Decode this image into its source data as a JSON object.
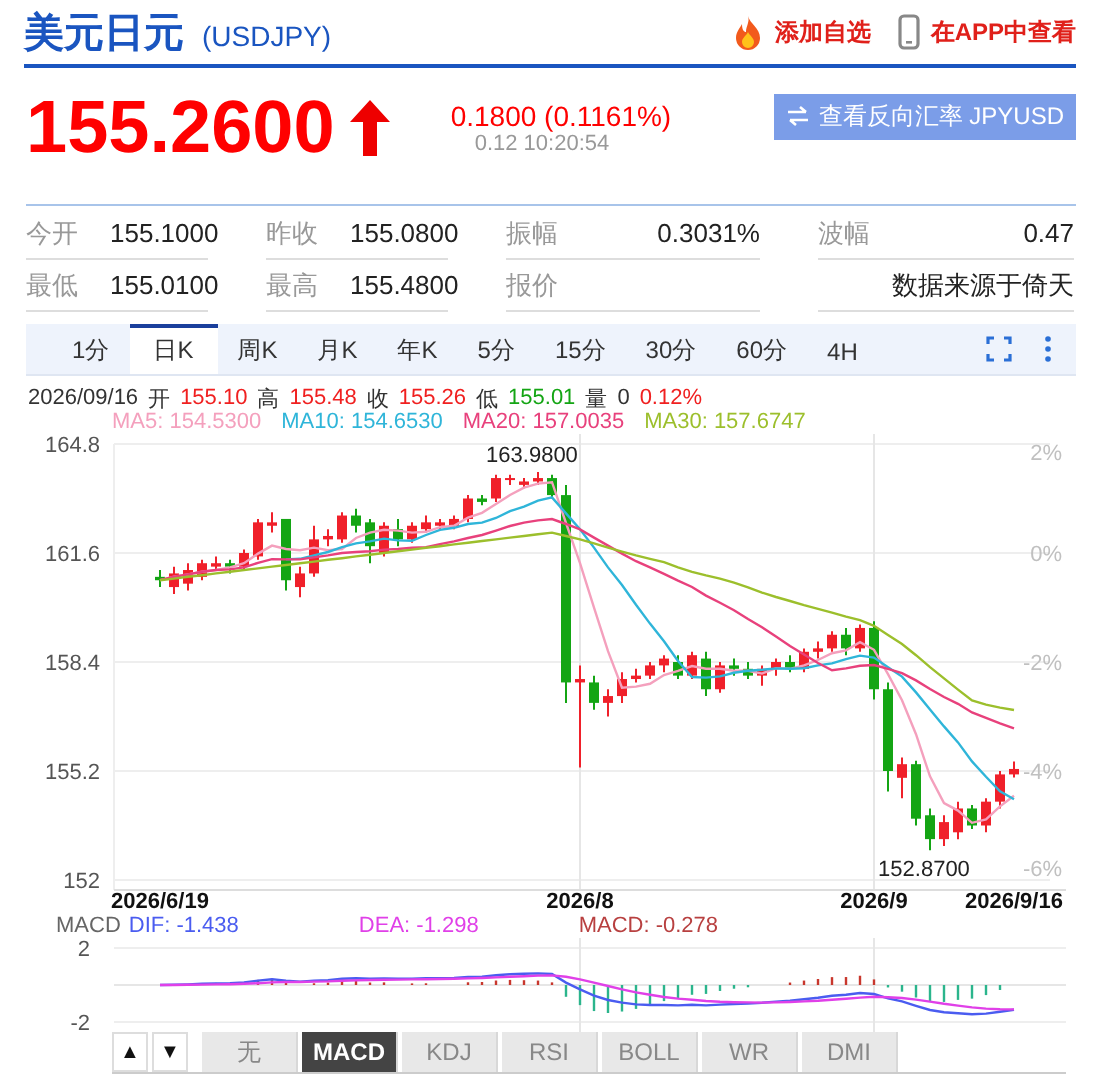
{
  "header": {
    "title": "美元日元",
    "code": "(USDJPY)",
    "actions": [
      {
        "kind": "fire",
        "label": "添加自选"
      },
      {
        "kind": "phone",
        "label": "在APP中查看"
      }
    ]
  },
  "quote": {
    "price": "155.2600",
    "change": "0.1800 (0.1161%)",
    "time": "0.12 10:20:54",
    "reverse_button": "查看反向汇率 JPYUSD"
  },
  "stats": [
    {
      "label": "今开",
      "value": "155.1000"
    },
    {
      "label": "昨收",
      "value": "155.0800"
    },
    {
      "label": "振幅",
      "value": "0.3031%"
    },
    {
      "label": "波幅",
      "value": "0.47"
    },
    {
      "label": "最低",
      "value": "155.0100"
    },
    {
      "label": "最高",
      "value": "155.4800"
    },
    {
      "label": "报价"
    },
    {
      "value": "数据来源于倚天"
    }
  ],
  "period_tabs": [
    {
      "label": "1分",
      "selected": false
    },
    {
      "label": "日K",
      "selected": true
    },
    {
      "label": "周K",
      "selected": false
    },
    {
      "label": "月K",
      "selected": false
    },
    {
      "label": "年K",
      "selected": false
    },
    {
      "label": "5分",
      "selected": false
    },
    {
      "label": "15分",
      "selected": false
    },
    {
      "label": "30分",
      "selected": false
    },
    {
      "label": "60分",
      "selected": false
    },
    {
      "label": "4H",
      "selected": false
    }
  ],
  "kline": {
    "date": "2026/09/16",
    "info": [
      {
        "label": "开",
        "value": "155.10",
        "color": "#f02020"
      },
      {
        "label": "高",
        "value": "155.48",
        "color": "#f02020"
      },
      {
        "label": "收",
        "value": "155.26",
        "color": "#f02020"
      },
      {
        "label": "低",
        "value": "155.01",
        "color": "#14a514"
      },
      {
        "label": "量",
        "value": "0",
        "color": "#333333"
      },
      {
        "value": "0.12%",
        "color": "#f02020"
      }
    ],
    "percent_labels": [
      "2%",
      "0%",
      "-2%",
      "-4%",
      "-6%"
    ],
    "chart_data": {
      "type": "candlestick",
      "grid": true,
      "ohlc": [
        [
          160.9,
          161.1,
          160.6,
          160.8
        ],
        [
          160.6,
          161.2,
          160.4,
          161.0
        ],
        [
          160.7,
          161.3,
          160.5,
          161.1
        ],
        [
          160.9,
          161.4,
          160.8,
          161.3
        ],
        [
          161.2,
          161.5,
          161.1,
          161.3
        ],
        [
          161.3,
          161.4,
          161.0,
          161.2
        ],
        [
          161.2,
          161.7,
          161.1,
          161.6
        ],
        [
          161.5,
          162.6,
          161.4,
          162.5
        ],
        [
          162.4,
          162.8,
          162.2,
          162.5
        ],
        [
          162.6,
          162.6,
          160.5,
          160.8
        ],
        [
          160.6,
          161.2,
          160.3,
          161.0
        ],
        [
          161.0,
          162.4,
          160.9,
          162.0
        ],
        [
          162.0,
          162.3,
          161.8,
          162.1
        ],
        [
          162.0,
          162.8,
          161.9,
          162.7
        ],
        [
          162.7,
          162.9,
          162.2,
          162.4
        ],
        [
          162.5,
          162.6,
          161.3,
          161.8
        ],
        [
          161.6,
          162.5,
          161.5,
          162.4
        ],
        [
          162.3,
          162.6,
          161.8,
          162.0
        ],
        [
          162.0,
          162.5,
          161.9,
          162.4
        ],
        [
          162.3,
          162.7,
          162.2,
          162.5
        ],
        [
          162.4,
          162.6,
          162.3,
          162.5
        ],
        [
          162.4,
          162.7,
          162.3,
          162.6
        ],
        [
          162.6,
          163.3,
          162.5,
          163.2
        ],
        [
          163.2,
          163.3,
          163.0,
          163.1
        ],
        [
          163.2,
          163.9,
          163.1,
          163.8
        ],
        [
          163.8,
          163.9,
          163.6,
          163.8
        ],
        [
          163.6,
          163.8,
          163.5,
          163.7
        ],
        [
          163.7,
          163.98,
          163.6,
          163.8
        ],
        [
          163.8,
          163.9,
          163.2,
          163.3
        ],
        [
          163.3,
          163.6,
          157.2,
          157.8
        ],
        [
          157.8,
          158.3,
          155.3,
          157.9
        ],
        [
          157.8,
          158.0,
          157.0,
          157.2
        ],
        [
          157.2,
          157.6,
          156.8,
          157.4
        ],
        [
          157.4,
          158.1,
          157.2,
          157.9
        ],
        [
          157.9,
          158.2,
          157.8,
          158.0
        ],
        [
          158.0,
          158.4,
          157.9,
          158.3
        ],
        [
          158.3,
          158.6,
          158.1,
          158.5
        ],
        [
          158.4,
          158.6,
          157.9,
          158.0
        ],
        [
          158.0,
          158.7,
          157.9,
          158.6
        ],
        [
          158.5,
          158.7,
          157.4,
          157.6
        ],
        [
          157.6,
          158.4,
          157.5,
          158.3
        ],
        [
          158.3,
          158.5,
          158.0,
          158.2
        ],
        [
          158.2,
          158.4,
          157.9,
          158.0
        ],
        [
          158.0,
          158.3,
          157.7,
          158.2
        ],
        [
          158.2,
          158.5,
          158.0,
          158.4
        ],
        [
          158.4,
          158.6,
          158.1,
          158.2
        ],
        [
          158.2,
          158.8,
          158.1,
          158.7
        ],
        [
          158.7,
          159.0,
          158.5,
          158.8
        ],
        [
          158.8,
          159.3,
          158.7,
          159.2
        ],
        [
          159.2,
          159.4,
          158.6,
          158.8
        ],
        [
          158.8,
          159.5,
          158.7,
          159.4
        ],
        [
          159.4,
          159.6,
          157.3,
          157.6
        ],
        [
          157.6,
          157.8,
          154.6,
          155.2
        ],
        [
          155.0,
          155.6,
          154.4,
          155.4
        ],
        [
          155.4,
          155.5,
          153.6,
          153.8
        ],
        [
          153.9,
          154.1,
          152.87,
          153.2
        ],
        [
          153.2,
          153.9,
          153.0,
          153.7
        ],
        [
          153.4,
          154.3,
          153.2,
          154.1
        ],
        [
          154.1,
          154.2,
          153.5,
          153.6
        ],
        [
          153.6,
          154.4,
          153.4,
          154.3
        ],
        [
          154.3,
          155.2,
          154.1,
          155.1
        ],
        [
          155.1,
          155.48,
          155.01,
          155.26
        ]
      ],
      "ylim": [
        152,
        164.8
      ],
      "yticks": [
        {
          "value": 164.8,
          "label": "164.8"
        },
        {
          "value": 161.6,
          "label": "161.6"
        },
        {
          "value": 158.4,
          "label": "158.4"
        },
        {
          "value": 155.2,
          "label": "155.2"
        },
        {
          "value": 152,
          "label": "152"
        }
      ],
      "categories": [
        "2026/6/19",
        null,
        null,
        null,
        null,
        null,
        null,
        null,
        null,
        null,
        null,
        null,
        null,
        null,
        null,
        null,
        null,
        null,
        null,
        null,
        null,
        null,
        null,
        null,
        null,
        null,
        null,
        null,
        null,
        null,
        "2026/8",
        null,
        null,
        null,
        null,
        null,
        null,
        null,
        null,
        null,
        null,
        null,
        null,
        null,
        null,
        null,
        null,
        null,
        null,
        null,
        null,
        "2026/9",
        null,
        null,
        null,
        null,
        null,
        null,
        null,
        null,
        null,
        "2026/9/16"
      ],
      "series": [
        {
          "name": "MA5: 154.5300",
          "type": "line",
          "color": "#f4a0bd",
          "values": [
            160.8,
            160.9,
            160.97,
            161.05,
            161.1,
            161.18,
            161.3,
            161.58,
            161.82,
            161.72,
            161.68,
            161.76,
            161.68,
            161.72,
            162.04,
            162.2,
            162.28,
            162.26,
            162.2,
            162.22,
            162.36,
            162.4,
            162.64,
            162.78,
            163.04,
            163.3,
            163.52,
            163.64,
            163.68,
            162.48,
            161.3,
            160.0,
            158.72,
            157.64,
            157.68,
            157.76,
            158.02,
            158.14,
            158.28,
            158.2,
            158.2,
            158.14,
            158.14,
            158.06,
            158.22,
            158.2,
            158.3,
            158.46,
            158.66,
            158.74,
            158.98,
            158.76,
            158.04,
            157.28,
            156.28,
            155.04,
            154.26,
            154.04,
            153.68,
            153.78,
            154.16,
            154.47
          ]
        },
        {
          "name": "MA10: 154.6530",
          "type": "line",
          "color": "#2fb5d9",
          "values": [
            null,
            null,
            null,
            null,
            null,
            null,
            null,
            null,
            null,
            161.41,
            161.43,
            161.53,
            161.63,
            161.77,
            161.88,
            161.94,
            162.02,
            161.97,
            161.96,
            162.13,
            162.28,
            162.34,
            162.45,
            162.49,
            162.63,
            162.83,
            162.96,
            163.14,
            163.23,
            162.76,
            162.3,
            161.76,
            161.18,
            160.66,
            160.08,
            159.53,
            159.01,
            158.43,
            157.96,
            157.94,
            157.98,
            158.08,
            158.14,
            158.17,
            158.21,
            158.2,
            158.22,
            158.3,
            158.36,
            158.48,
            158.59,
            158.53,
            158.25,
            157.97,
            157.51,
            157.01,
            156.51,
            156.04,
            155.48,
            155.03,
            154.6,
            154.37
          ]
        },
        {
          "name": "MA20: 157.0035",
          "type": "line",
          "color": "#e8417c",
          "values": [
            160.8,
            160.9,
            160.97,
            161.05,
            161.1,
            161.12,
            161.18,
            161.31,
            161.42,
            161.41,
            161.41,
            161.47,
            161.53,
            161.6,
            161.63,
            161.65,
            161.7,
            161.72,
            161.75,
            161.77,
            161.86,
            161.94,
            162.04,
            162.13,
            162.26,
            162.39,
            162.49,
            162.56,
            162.6,
            162.45,
            162.29,
            162.05,
            161.82,
            161.58,
            161.36,
            161.18,
            160.99,
            160.79,
            160.6,
            160.35,
            160.14,
            159.92,
            159.66,
            159.42,
            159.15,
            158.87,
            158.62,
            158.37,
            158.16,
            158.21,
            158.29,
            158.31,
            158.2,
            158.07,
            157.86,
            157.61,
            157.37,
            157.17,
            156.92,
            156.76,
            156.6,
            156.45
          ]
        },
        {
          "name": "MA30: 157.6747",
          "type": "line",
          "color": "#9cbf2c",
          "values": [
            160.8,
            160.85,
            160.9,
            160.95,
            161.0,
            161.05,
            161.1,
            161.15,
            161.2,
            161.25,
            161.3,
            161.35,
            161.4,
            161.45,
            161.5,
            161.55,
            161.6,
            161.65,
            161.7,
            161.75,
            161.8,
            161.85,
            161.9,
            161.95,
            162.0,
            162.05,
            162.1,
            162.15,
            162.2,
            162.1,
            162.0,
            161.88,
            161.76,
            161.64,
            161.53,
            161.43,
            161.33,
            161.18,
            161.05,
            160.94,
            160.85,
            160.73,
            160.59,
            160.44,
            160.31,
            160.19,
            160.07,
            159.96,
            159.85,
            159.73,
            159.63,
            159.46,
            159.19,
            158.93,
            158.6,
            158.25,
            157.92,
            157.59,
            157.27,
            157.15,
            157.06,
            156.99
          ]
        }
      ],
      "annotations": [
        "163.9800",
        "152.8700"
      ]
    }
  },
  "macd": {
    "title": "MACD",
    "legend": [
      {
        "text": "DIF: -1.438",
        "color": "#4a5cf0"
      },
      {
        "text": "DEA: -1.298",
        "color": "#e040e8"
      },
      {
        "text": "MACD: -0.278",
        "color": "#b84040"
      }
    ],
    "ticks": [
      "2",
      "-2"
    ]
  },
  "indicator_tabs": {
    "arrows": [
      "▲",
      "▼"
    ],
    "tabs": [
      {
        "label": "无",
        "selected": false
      },
      {
        "label": "MACD",
        "selected": true
      },
      {
        "label": "KDJ",
        "selected": false
      },
      {
        "label": "RSI",
        "selected": false
      },
      {
        "label": "BOLL",
        "selected": false
      },
      {
        "label": "WR",
        "selected": false
      },
      {
        "label": "DMI",
        "selected": false
      }
    ]
  }
}
